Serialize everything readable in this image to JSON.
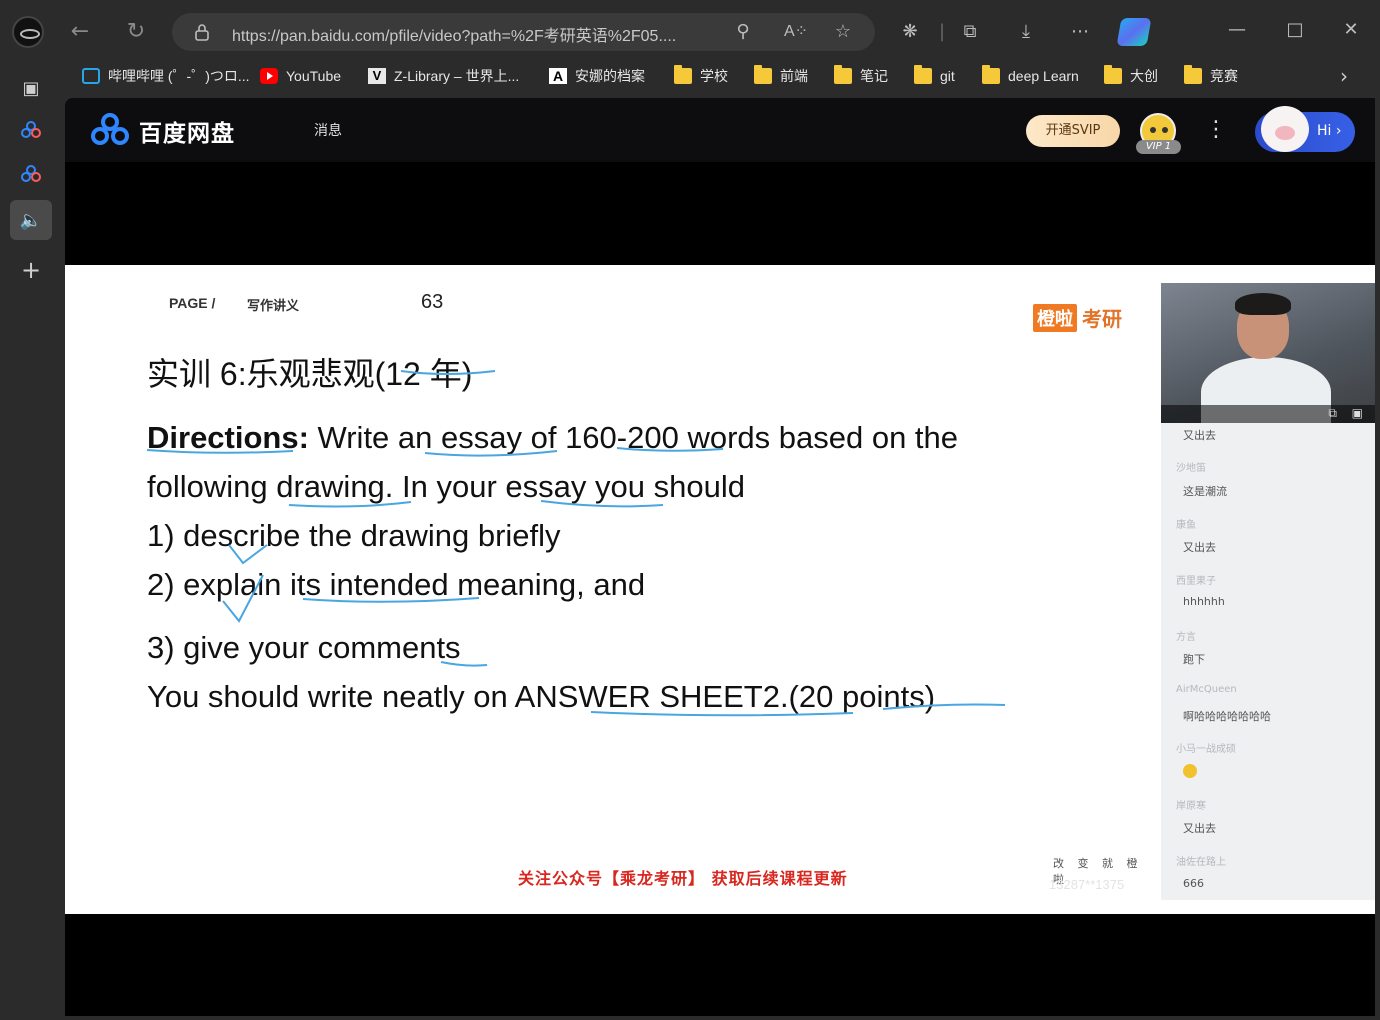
{
  "browser": {
    "url": "https://pan.baidu.com/pfile/video?path=%2F考研英语%2F05....",
    "bookmarks": [
      {
        "label": "哔哩哔哩 (゜-゜)つロ...",
        "icon": "bilibili-icon"
      },
      {
        "label": "YouTube",
        "icon": "youtube-icon"
      },
      {
        "label": "Z-Library – 世界上...",
        "icon": "zlibrary-icon"
      },
      {
        "label": "安娜的档案",
        "icon": "annas-archive-icon"
      },
      {
        "label": "学校",
        "icon": "folder-icon"
      },
      {
        "label": "前端",
        "icon": "folder-icon"
      },
      {
        "label": "笔记",
        "icon": "folder-icon"
      },
      {
        "label": "git",
        "icon": "folder-icon"
      },
      {
        "label": "deep Learn",
        "icon": "folder-icon"
      },
      {
        "label": "大创",
        "icon": "folder-icon"
      },
      {
        "label": "竞赛",
        "icon": "folder-icon"
      }
    ]
  },
  "baidu": {
    "logo_text": "百度网盘",
    "messages": "消息",
    "svip_button": "开通SVIP",
    "vip_level": "VIP 1",
    "hi_button": "Hi ›"
  },
  "slide": {
    "page_label": "PAGE /",
    "page_section": "写作讲义",
    "page_number": "63",
    "brand_box": "橙啦",
    "brand_text": "考研",
    "title": "实训 6:乐观悲观(12 年)",
    "directions_label": "Directions:",
    "line1": " Write an essay of 160-200 words based on the",
    "line2": "following drawing. In your essay you should",
    "line3": "1) describe the drawing briefly",
    "line4": "2) explain its intended meaning, and",
    "line5": "3) give your comments",
    "line6": "You should write neatly on ANSWER SHEET2.(20 points)",
    "footer_promo": "关注公众号【乘龙考研】 获取后续课程更新",
    "slogan": "改 变 就 橙 啦",
    "watermark": "13287**1375"
  },
  "chat": [
    {
      "name": "",
      "message": "又出去"
    },
    {
      "name": "沙地笛",
      "message": "这是潮流"
    },
    {
      "name": "康鱼",
      "message": "又出去"
    },
    {
      "name": "西里果子",
      "message": "hhhhhh"
    },
    {
      "name": "方言",
      "message": "跑下"
    },
    {
      "name": "AirMcQueen",
      "message": "啊哈哈哈哈哈哈哈"
    },
    {
      "name": "小马一战成硕",
      "message": ""
    },
    {
      "name": "岸原寒",
      "message": "又出去"
    },
    {
      "name": "油佐在路上",
      "message": "666"
    }
  ],
  "colors": {
    "accent_blue": "#2f87ff",
    "brand_orange": "#f07a24",
    "promo_red": "#d9271f",
    "annotation_blue": "#4aa6e0"
  }
}
